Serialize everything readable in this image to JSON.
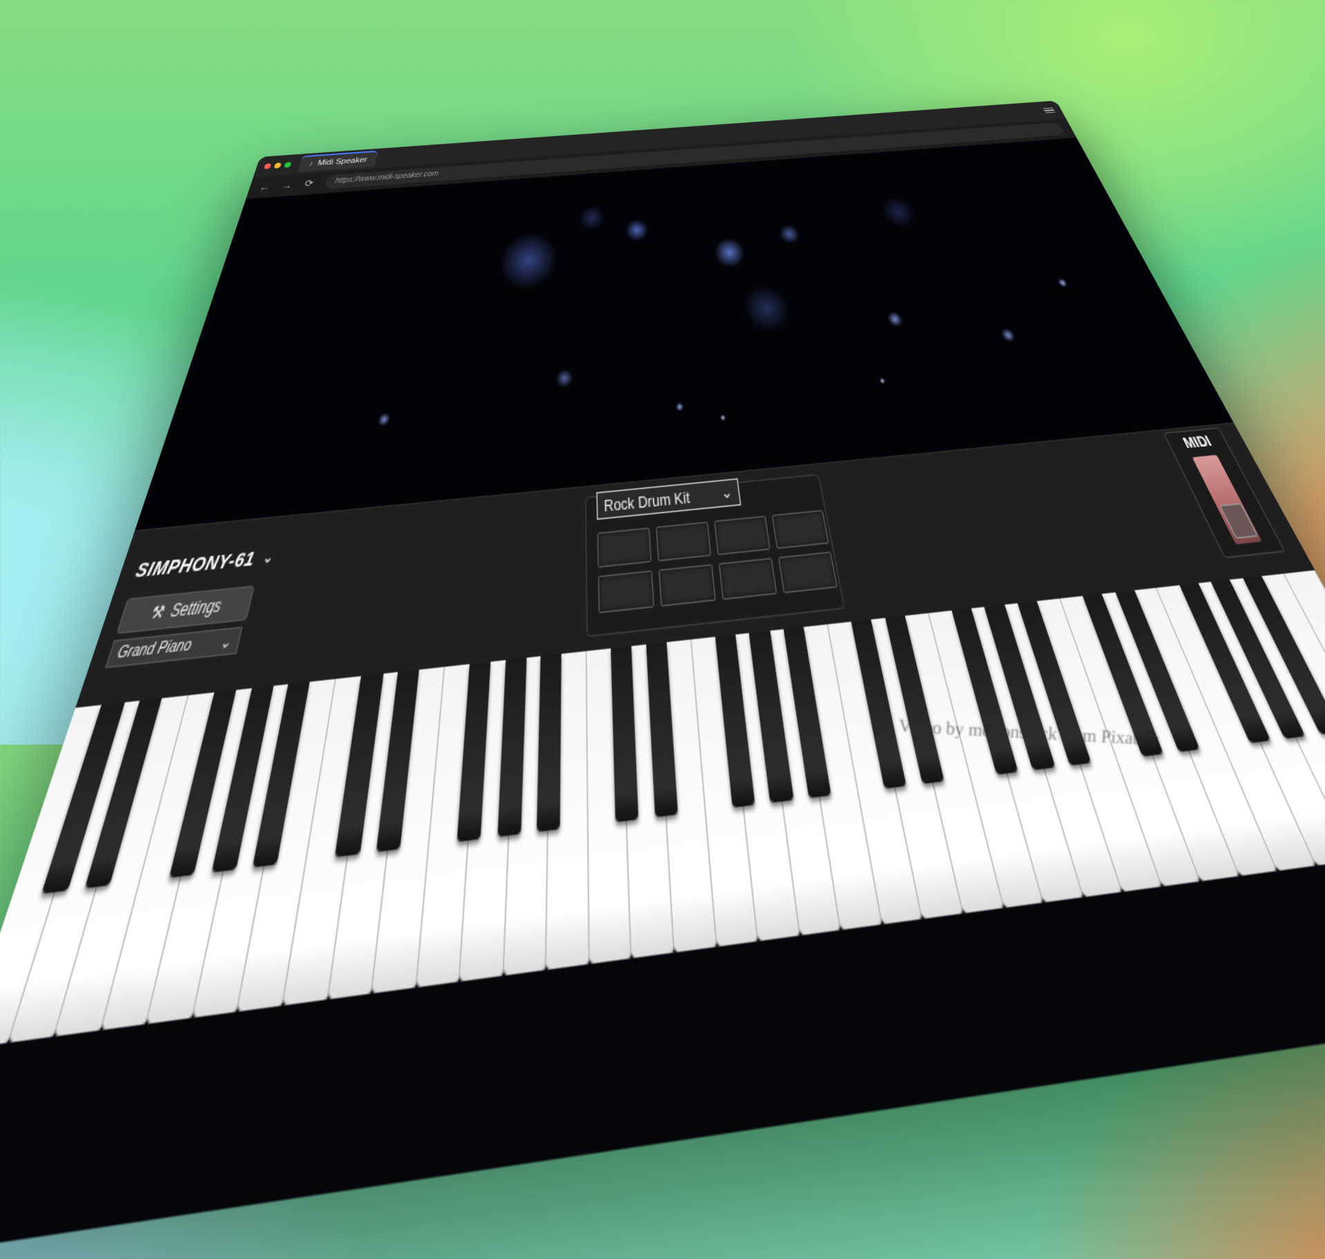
{
  "browser": {
    "tab_title": "Midi Speaker",
    "url": "https://www.midi-speaker.com",
    "nav": {
      "back": "←",
      "forward": "→",
      "reload": "⟳"
    }
  },
  "app": {
    "instrument_name": "SIMPHONY-61",
    "settings_label": "Settings",
    "voice_selected": "Grand Piano",
    "drum_kit_selected": "Rock Drum Kit",
    "pad_count": 8,
    "midi_label": "MIDI",
    "white_key_count": 36
  },
  "colors": {
    "background_green": "#63d58d",
    "background_cyan": "#a6f0f6",
    "background_orange": "#e0935a",
    "window": "#151515",
    "midi_fader": "#d99a9a"
  },
  "icons": {
    "settings": "wrench-icon",
    "dropdown": "chevron-down-icon",
    "tab": "music-note-icon",
    "menu": "hamburger-menu-icon"
  },
  "credit": "Video by motionstock from Pixabay"
}
